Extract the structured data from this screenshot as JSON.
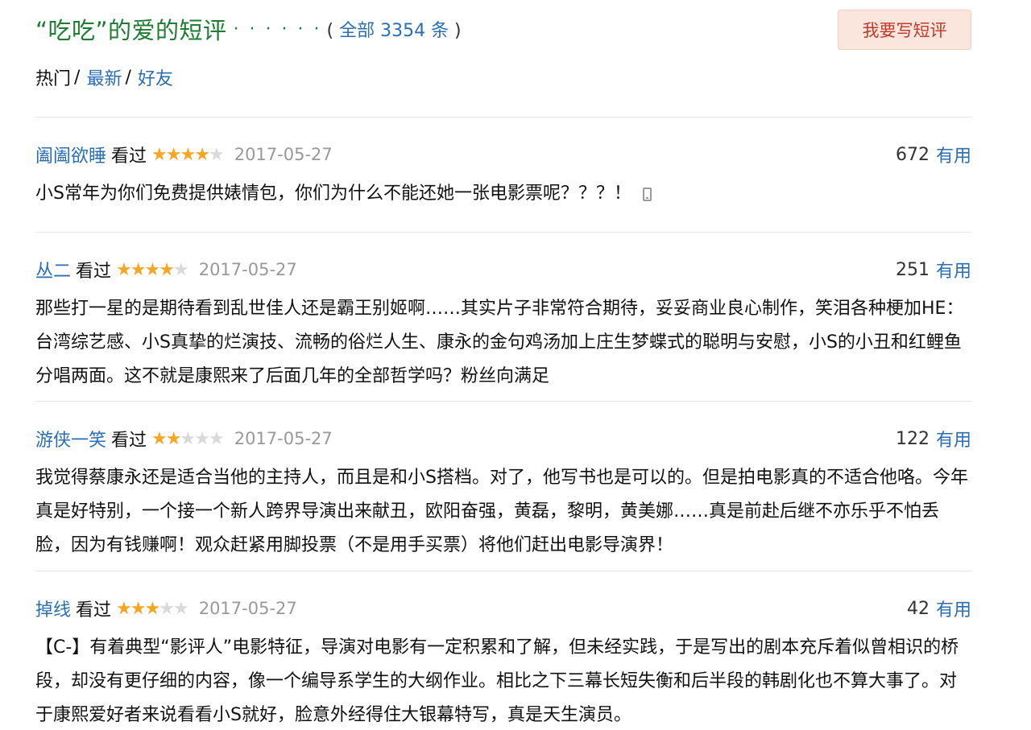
{
  "header": {
    "title": "“吃吃”的爱的短评",
    "dots": "· · · · · ·",
    "count_open": "( ",
    "count_label": "全部 3354 条",
    "count_close": " )",
    "write_button": "我要写短评"
  },
  "filters": {
    "hot": "热门",
    "sep1": "/",
    "latest": "最新",
    "sep2": "/",
    "friends": "好友"
  },
  "reviews": [
    {
      "user": "阖阖欲睡",
      "status": "看过",
      "rating": 4,
      "date": "2017-05-27",
      "votes": "672",
      "useful": "有用",
      "text": "小S常年为你们免费提供婊情包，你们为什么不能还她一张电影票呢？？？！",
      "has_phone_icon": true
    },
    {
      "user": "丛二",
      "status": "看过",
      "rating": 4,
      "date": "2017-05-27",
      "votes": "251",
      "useful": "有用",
      "text": "那些打一星的是期待看到乱世佳人还是霸王别姬啊……其实片子非常符合期待，妥妥商业良心制作，笑泪各种梗加HE：台湾综艺感、小S真挚的烂演技、流畅的俗烂人生、康永的金句鸡汤加上庄生梦蝶式的聪明与安慰，小S的小丑和红鲤鱼分唱两面。这不就是康熙来了后面几年的全部哲学吗？粉丝向满足"
    },
    {
      "user": "游侠一笑",
      "status": "看过",
      "rating": 2,
      "date": "2017-05-27",
      "votes": "122",
      "useful": "有用",
      "text": "我觉得蔡康永还是适合当他的主持人，而且是和小S搭档。对了，他写书也是可以的。但是拍电影真的不适合他咯。今年真是好特别，一个接一个新人跨界导演出来献丑，欧阳奋强，黄磊，黎明，黄美娜……真是前赴后继不亦乐乎不怕丢脸，因为有钱赚啊！观众赶紧用脚投票（不是用手买票）将他们赶出电影导演界！"
    },
    {
      "user": "掉线",
      "status": "看过",
      "rating": 3,
      "date": "2017-05-27",
      "votes": "42",
      "useful": "有用",
      "text": "【C-】有着典型“影评人”电影特征，导演对电影有一定积累和了解，但未经实践，于是写出的剧本充斥着似曾相识的桥段，却没有更仔细的内容，像一个编导系学生的大纲作业。相比之下三幕长短失衡和后半段的韩剧化也不算大事了。对于康熙爱好者来说看看小S就好，脸意外经得住大银幕特写，真是天生演员。"
    }
  ],
  "colors": {
    "title_green": "#1e7d32",
    "link_blue": "#2a6eb5",
    "star_on": "#f5a623",
    "star_off": "#d9d9d9",
    "date_gray": "#999999",
    "button_bg": "#fbe6de",
    "button_text": "#c03b2b"
  },
  "icons": {
    "mobile": "phone-icon"
  }
}
